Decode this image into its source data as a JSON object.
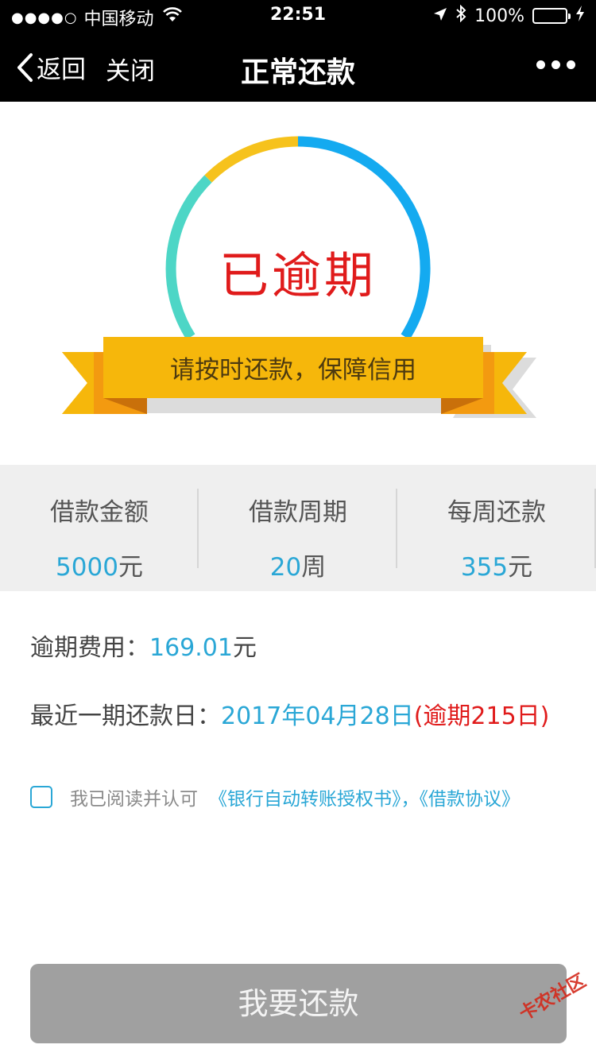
{
  "status_bar": {
    "signal": "●●●●○",
    "carrier": "中国移动",
    "time": "22:51",
    "battery": "100%"
  },
  "nav": {
    "back_label": "返回",
    "close_label": "关闭",
    "title": "正常还款"
  },
  "hero": {
    "status": "已逾期",
    "ribbon": "请按时还款，保障信用"
  },
  "summary": [
    {
      "label": "借款金额",
      "value": "5000",
      "unit": "元"
    },
    {
      "label": "借款周期",
      "value": "20",
      "unit": "周"
    },
    {
      "label": "每周还款",
      "value": "355",
      "unit": "元"
    }
  ],
  "details": {
    "overdue_fee_label": "逾期费用：",
    "overdue_fee_value": "169.01",
    "overdue_fee_unit": "元",
    "due_date_label": "最近一期还款日：",
    "due_date_value": "2017年04月28日",
    "overdue_days": "(逾期215日)"
  },
  "agreement": {
    "text": "我已阅读并认可",
    "links": "《银行自动转账授权书》，《借款协议》"
  },
  "button": {
    "label": "我要还款"
  },
  "watermark": "卡农社区",
  "colors": {
    "header_bg": "#000000",
    "accent_blue": "#2aa7d6",
    "alert_red": "#e01b1b",
    "ribbon_yellow": "#f6b70b",
    "ribbon_orange": "#f39a10",
    "ring_teal": "#4dd6c6",
    "ring_blue": "#14aaf0",
    "button_gray": "#a0a0a0"
  }
}
